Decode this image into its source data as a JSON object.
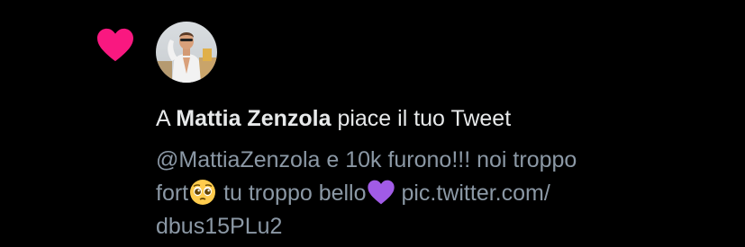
{
  "notification": {
    "type_icon": "heart-icon",
    "avatar": "user-avatar",
    "title_prefix": "A ",
    "user_name": "Mattia Zenzola",
    "title_suffix": " piace il tuo Tweet",
    "tweet": {
      "line1": "@MattiaZenzola e 10k furono!!! noi troppo",
      "line2_part1": "fort",
      "emoji1": "pleading-face-emoji",
      "line2_part2": " tu troppo bello",
      "emoji2": "purple-heart-emoji",
      "line2_part3": " pic.twitter.com/",
      "line3": "dbus15PLu2"
    }
  },
  "colors": {
    "background": "#000000",
    "heart": "#f91880",
    "primary_text": "#e7e9ea",
    "secondary_text": "#8b98a5"
  }
}
